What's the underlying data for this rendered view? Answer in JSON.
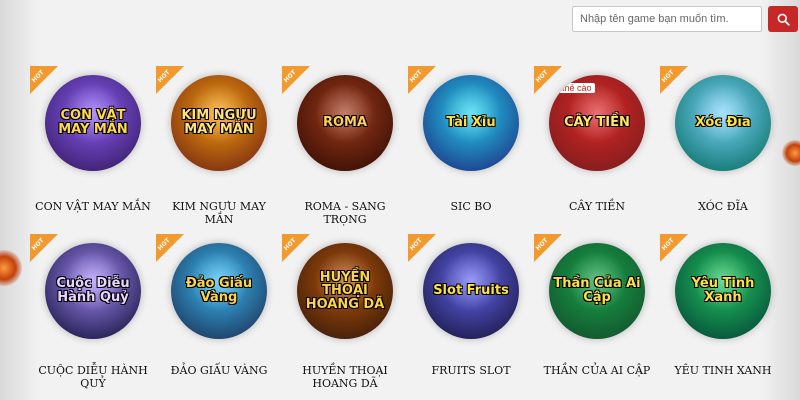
{
  "search": {
    "placeholder": "Nhập tên game bạn muốn tìm.",
    "button_icon": "search-icon"
  },
  "hot_label": "HOT",
  "games": [
    {
      "id": "con-vat-may-man",
      "label": "CON VẬT MAY MẮN",
      "art_title": "CON VẬT MAY MẮN",
      "colors": [
        "#8b5cf6",
        "#3b1f6b"
      ],
      "title_color": "#ffd84d",
      "hot": true
    },
    {
      "id": "kim-nguu-may-man",
      "label": "KIM NGƯU MAY MẮN",
      "art_title": "KIM NGƯU MAY MẮN",
      "colors": [
        "#f59e0b",
        "#7c2d12"
      ],
      "title_color": "#ffe27a",
      "hot": true
    },
    {
      "id": "roma",
      "label": "ROMA - SANG TRỌNG",
      "art_title": "ROMA",
      "colors": [
        "#a13a1a",
        "#3a0f05"
      ],
      "title_color": "#ffcf5a",
      "hot": true
    },
    {
      "id": "sic-bo",
      "label": "SIC BO",
      "art_title": "Tài Xỉu",
      "colors": [
        "#22d3ee",
        "#1e3a8a"
      ],
      "title_color": "#fde047",
      "hot": true
    },
    {
      "id": "cay-tien",
      "label": "CÂY TIỀN",
      "art_title": "CÂY TIỀN",
      "badge": "thẻ cào",
      "colors": [
        "#dc2626",
        "#7f1d1d"
      ],
      "title_color": "#ffe66b",
      "hot": true
    },
    {
      "id": "xoc-dia",
      "label": "XÓC ĐĨA",
      "art_title": "Xóc Đĩa",
      "colors": [
        "#7dd3fc",
        "#0f766e"
      ],
      "title_color": "#fde047",
      "hot": true
    },
    {
      "id": "cuoc-dieu-hanh-quy",
      "label": "CUỘC DIỄU HÀNH QUỶ",
      "art_title": "Cuộc Diễu Hành Quỷ",
      "colors": [
        "#a78bfa",
        "#1e1b4b"
      ],
      "title_color": "#e9d5ff",
      "hot": true
    },
    {
      "id": "dao-giau-vang",
      "label": "ĐẢO GIẤU VÀNG",
      "art_title": "Đảo Giấu Vàng",
      "colors": [
        "#38bdf8",
        "#1e3a5f"
      ],
      "title_color": "#fcd34d",
      "hot": true
    },
    {
      "id": "huyen-thoai-hoang-da",
      "label": "HUYỀN THOẠI HOANG DÃ",
      "art_title": "HUYỀN THOẠI HOANG DÃ",
      "colors": [
        "#b45309",
        "#3f1d0b"
      ],
      "title_color": "#fcd34d",
      "hot": true
    },
    {
      "id": "fruits-slot",
      "label": "FRUITS SLOT",
      "art_title": "Slot Fruits",
      "colors": [
        "#6366f1",
        "#1e1b4b"
      ],
      "title_color": "#fde047",
      "hot": true
    },
    {
      "id": "than-cua-ai-cap",
      "label": "THẦN CỦA AI CẬP",
      "art_title": "Thần Của Ai Cập",
      "colors": [
        "#16a34a",
        "#14532d"
      ],
      "title_color": "#fde047",
      "hot": true
    },
    {
      "id": "yeu-tinh-xanh",
      "label": "YÊU TINH XANH",
      "art_title": "Yêu Tinh Xanh",
      "colors": [
        "#22c55e",
        "#064e3b"
      ],
      "title_color": "#fde047",
      "hot": true
    }
  ]
}
